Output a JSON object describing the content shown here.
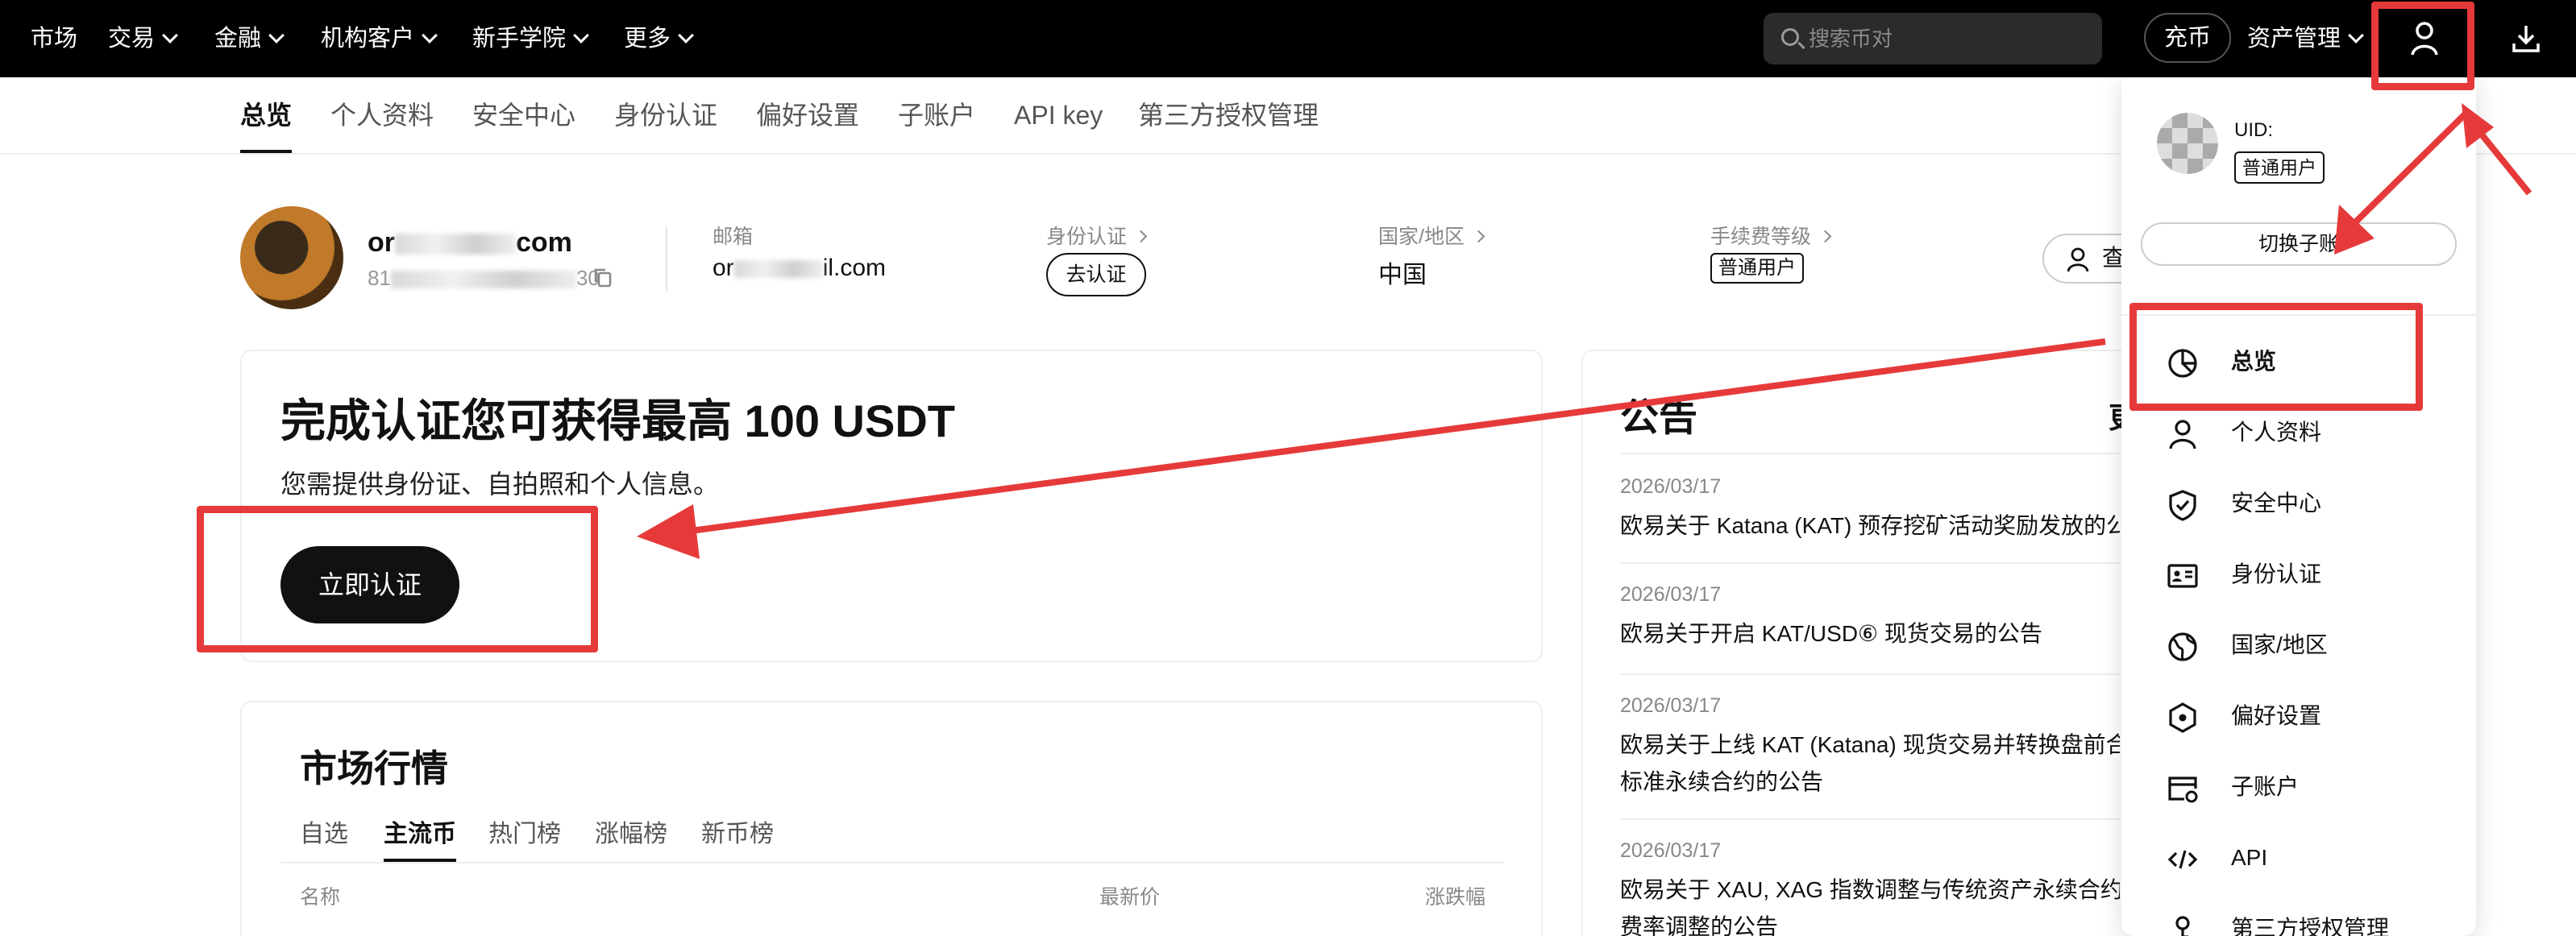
{
  "topnav": {
    "items": [
      {
        "label": "市场",
        "has_chevron": false
      },
      {
        "label": "交易",
        "has_chevron": true
      },
      {
        "label": "金融",
        "has_chevron": true
      },
      {
        "label": "机构客户",
        "has_chevron": true
      },
      {
        "label": "新手学院",
        "has_chevron": true
      },
      {
        "label": "更多",
        "has_chevron": true
      }
    ],
    "search_placeholder": "搜索币对",
    "deposit_label": "充币",
    "asset_label": "资产管理"
  },
  "subnav": {
    "tabs": [
      "总览",
      "个人资料",
      "安全中心",
      "身份认证",
      "偏好设置",
      "子账户",
      "API key",
      "第三方授权管理"
    ],
    "active": "总览"
  },
  "profile": {
    "name_start": "or",
    "name_end": "com",
    "uid_start": "81",
    "uid_end": "30",
    "email_label": "邮箱",
    "email_start": "or",
    "email_end": "il.com",
    "kyc_label": "身份认证",
    "kyc_button": "去认证",
    "country_label": "国家/地区",
    "country_value": "中国",
    "fee_label": "手续费等级",
    "fee_value": "普通用户",
    "view_button": "查"
  },
  "verify_card": {
    "title": "完成认证您可获得最高 100 USDT",
    "description": "您需提供身份证、自拍照和个人信息。",
    "button": "立即认证"
  },
  "market": {
    "title": "市场行情",
    "tabs": [
      "自选",
      "主流币",
      "热门榜",
      "涨幅榜",
      "新币榜"
    ],
    "active_tab": "主流币",
    "columns": [
      "名称",
      "最新价",
      "涨跌幅"
    ]
  },
  "announcements": {
    "title": "公告",
    "more": "更",
    "items": [
      {
        "date": "2026/03/17",
        "lines": [
          "欧易关于 Katana (KAT) 预存挖矿活动奖励发放的公"
        ]
      },
      {
        "date": "2026/03/17",
        "lines": [
          "欧易关于开启 KAT/USD⑥ 现货交易的公告"
        ]
      },
      {
        "date": "2026/03/17",
        "lines": [
          "欧易关于上线 KAT (Katana) 现货交易并转换盘前合",
          "标准永续合约的公告"
        ]
      },
      {
        "date": "2026/03/17",
        "lines": [
          "欧易关于 XAU, XAG 指数调整与传统资产永续合约资",
          "费率调整的公告"
        ]
      }
    ]
  },
  "dropdown": {
    "uid_label": "UID:",
    "user_tag": "普通用户",
    "switch_label": "切换子账",
    "items": [
      {
        "label": "总览",
        "icon": "pie-chart-icon"
      },
      {
        "label": "个人资料",
        "icon": "person-icon"
      },
      {
        "label": "安全中心",
        "icon": "shield-icon"
      },
      {
        "label": "身份认证",
        "icon": "id-card-icon"
      },
      {
        "label": "国家/地区",
        "icon": "globe-icon"
      },
      {
        "label": "偏好设置",
        "icon": "settings-hexagon-icon"
      },
      {
        "label": "子账户",
        "icon": "sub-account-icon"
      },
      {
        "label": "API",
        "icon": "code-icon"
      },
      {
        "label": "第三方授权管理",
        "icon": "key-icon"
      }
    ],
    "active": "总览"
  },
  "colors": {
    "annotation_red": "#e63a3a",
    "nav_bg": "#000000",
    "primary_button": "#111111"
  }
}
